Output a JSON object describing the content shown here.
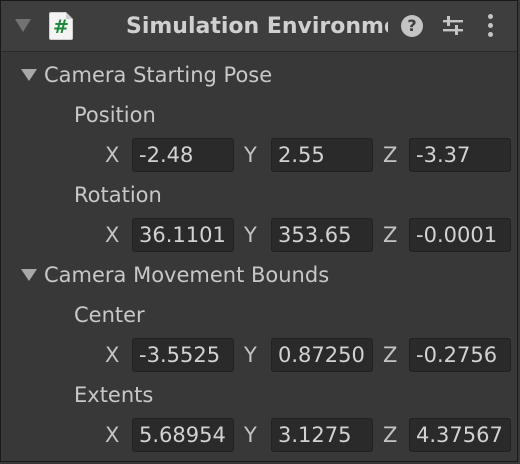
{
  "header": {
    "title": "Simulation Environmen",
    "script_icon": "#",
    "help_icon": "?"
  },
  "sections": [
    {
      "label": "Camera Starting Pose",
      "groups": [
        {
          "label": "Position",
          "x_label": "X",
          "y_label": "Y",
          "z_label": "Z",
          "x": "-2.48",
          "y": "2.55",
          "z": "-3.37"
        },
        {
          "label": "Rotation",
          "x_label": "X",
          "y_label": "Y",
          "z_label": "Z",
          "x": "36.1101",
          "y": "353.65",
          "z": "-0.0001"
        }
      ]
    },
    {
      "label": "Camera Movement Bounds",
      "groups": [
        {
          "label": "Center",
          "x_label": "X",
          "y_label": "Y",
          "z_label": "Z",
          "x": "-3.5525",
          "y": "0.87250",
          "z": "-0.2756"
        },
        {
          "label": "Extents",
          "x_label": "X",
          "y_label": "Y",
          "z_label": "Z",
          "x": "5.68954",
          "y": "3.1275",
          "z": "4.37567"
        }
      ]
    }
  ]
}
